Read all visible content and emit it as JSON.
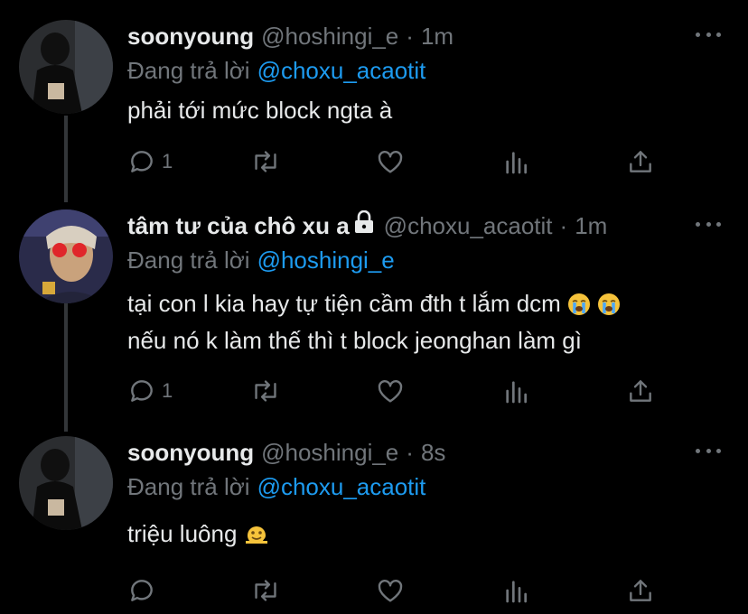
{
  "colors": {
    "background": "#000000",
    "text": "#e7e9ea",
    "secondary": "#71767b",
    "link": "#1d9bf0",
    "thread_line": "#333639"
  },
  "tweets": [
    {
      "display_name": "soonyoung",
      "handle": "@hoshingi_e",
      "separator": "·",
      "time": "1m",
      "reply_prefix": "Đang trả lời",
      "reply_to": "@choxu_acaotit",
      "lines": [
        "phải tới mức block ngta à"
      ],
      "reply_count": "1",
      "locked": false
    },
    {
      "display_name": "tâm tư của chô xu a",
      "handle": "@choxu_acaotit",
      "separator": "·",
      "time": "1m",
      "reply_prefix": "Đang trả lời",
      "reply_to": "@hoshingi_e",
      "lines": [
        "tại con l kia hay tự tiện cầm đth t lắm dcm",
        "nếu nó k làm thế thì t block jeonghan làm gì"
      ],
      "reply_count": "1",
      "locked": true
    },
    {
      "display_name": "soonyoung",
      "handle": "@hoshingi_e",
      "separator": "·",
      "time": "8s",
      "reply_prefix": "Đang trả lời",
      "reply_to": "@choxu_acaotit",
      "lines": [
        "triệu luông"
      ],
      "reply_count": "",
      "locked": false
    }
  ],
  "icons": [
    "reply-icon",
    "retweet-icon",
    "like-icon",
    "analytics-icon",
    "share-icon",
    "more-icon",
    "lock-icon",
    "crying-face-emoji",
    "melting-face-emoji"
  ]
}
